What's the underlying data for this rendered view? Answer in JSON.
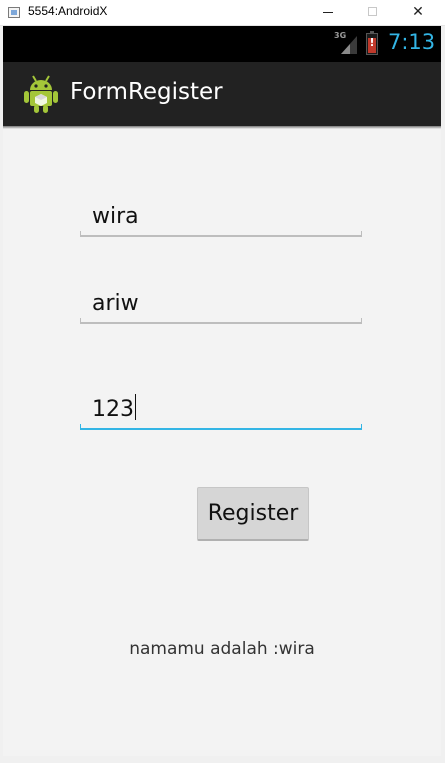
{
  "window": {
    "title": "5554:AndroidX",
    "minimize_glyph": "",
    "maximize_glyph": "",
    "close_glyph": "✕"
  },
  "statusbar": {
    "network": "3G",
    "battery_alert": "!",
    "time": "7:13",
    "time_color": "#33b5e5"
  },
  "actionbar": {
    "icon": "android-robot-icon",
    "title": "FormRegister",
    "background": "#222222"
  },
  "form": {
    "name_value": "wira",
    "second_value": "ariw",
    "third_value": "123",
    "focused_field": "third",
    "accent_color": "#33b5e5",
    "register_label": "Register"
  },
  "result": {
    "text": "namamu adalah :wira"
  }
}
